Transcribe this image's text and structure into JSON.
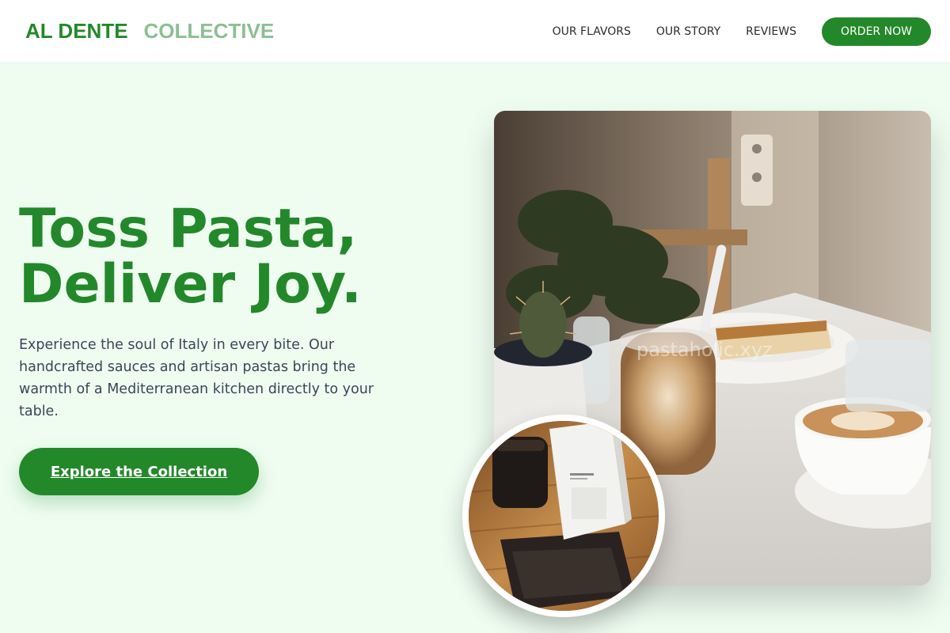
{
  "brand": {
    "name_part1": "AL DENTE",
    "name_part2": "COLLECTIVE"
  },
  "nav": {
    "items": [
      "OUR FLAVORS",
      "OUR STORY",
      "REVIEWS"
    ],
    "order_button": "ORDER NOW"
  },
  "hero": {
    "title_line1": "Toss Pasta,",
    "title_line2": "Deliver Joy.",
    "description": "Experience the soul of Italy in every bite. Our handcrafted sauces and artisan pastas bring the warmth of a Mediterranean kitchen directly to your table.",
    "cta_label": "Explore the Collection"
  },
  "images": {
    "main_watermark": "pastaholic.xyz",
    "main_alt": "Cafe table with cheesecake, iced latte, cappuccino and a small cactus",
    "inset_alt": "Coffee bag and iced coffee on a wooden table"
  },
  "colors": {
    "brand_green": "#23882a",
    "brand_green_light": "#8cbf93",
    "page_background": "#effdf1",
    "body_text": "#3a4657"
  }
}
